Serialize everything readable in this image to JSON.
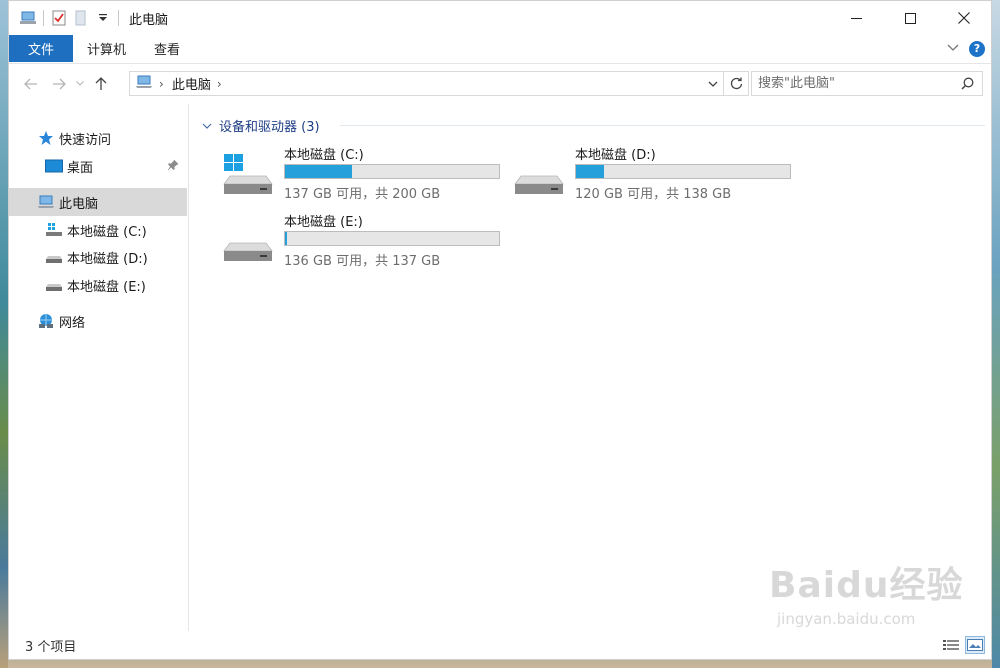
{
  "window": {
    "title": "此电脑"
  },
  "ribbon": {
    "file_tab": "文件",
    "tabs": [
      "计算机",
      "查看"
    ]
  },
  "address": {
    "path": "此电脑",
    "search_placeholder": "搜索\"此电脑\""
  },
  "sidebar": {
    "items": [
      {
        "label": "快速访问",
        "icon": "star-icon"
      },
      {
        "label": "桌面",
        "icon": "desktop-folder-icon"
      },
      {
        "label": "此电脑",
        "icon": "computer-icon"
      },
      {
        "label": "本地磁盘 (C:)",
        "icon": "windows-drive-icon"
      },
      {
        "label": "本地磁盘 (D:)",
        "icon": "drive-icon"
      },
      {
        "label": "本地磁盘 (E:)",
        "icon": "drive-icon"
      },
      {
        "label": "网络",
        "icon": "network-icon"
      }
    ]
  },
  "main": {
    "group_header": "设备和驱动器 (3)",
    "drives": [
      {
        "name": "本地磁盘 (C:)",
        "space": "137 GB 可用，共 200 GB",
        "used_fraction": 0.315,
        "icon": "windows-drive-icon"
      },
      {
        "name": "本地磁盘 (D:)",
        "space": "120 GB 可用，共 138 GB",
        "used_fraction": 0.13,
        "icon": "drive-icon"
      },
      {
        "name": "本地磁盘 (E:)",
        "space": "136 GB 可用，共 137 GB",
        "used_fraction": 0.01,
        "icon": "drive-icon"
      }
    ]
  },
  "status": {
    "item_count": "3 个项目"
  },
  "watermark": {
    "logo": "Baidu经验",
    "url": "jingyan.baidu.com"
  },
  "colors": {
    "accent": "#1e6fc0",
    "bar_fill": "#26a0da",
    "group_header": "#1e3e85"
  }
}
